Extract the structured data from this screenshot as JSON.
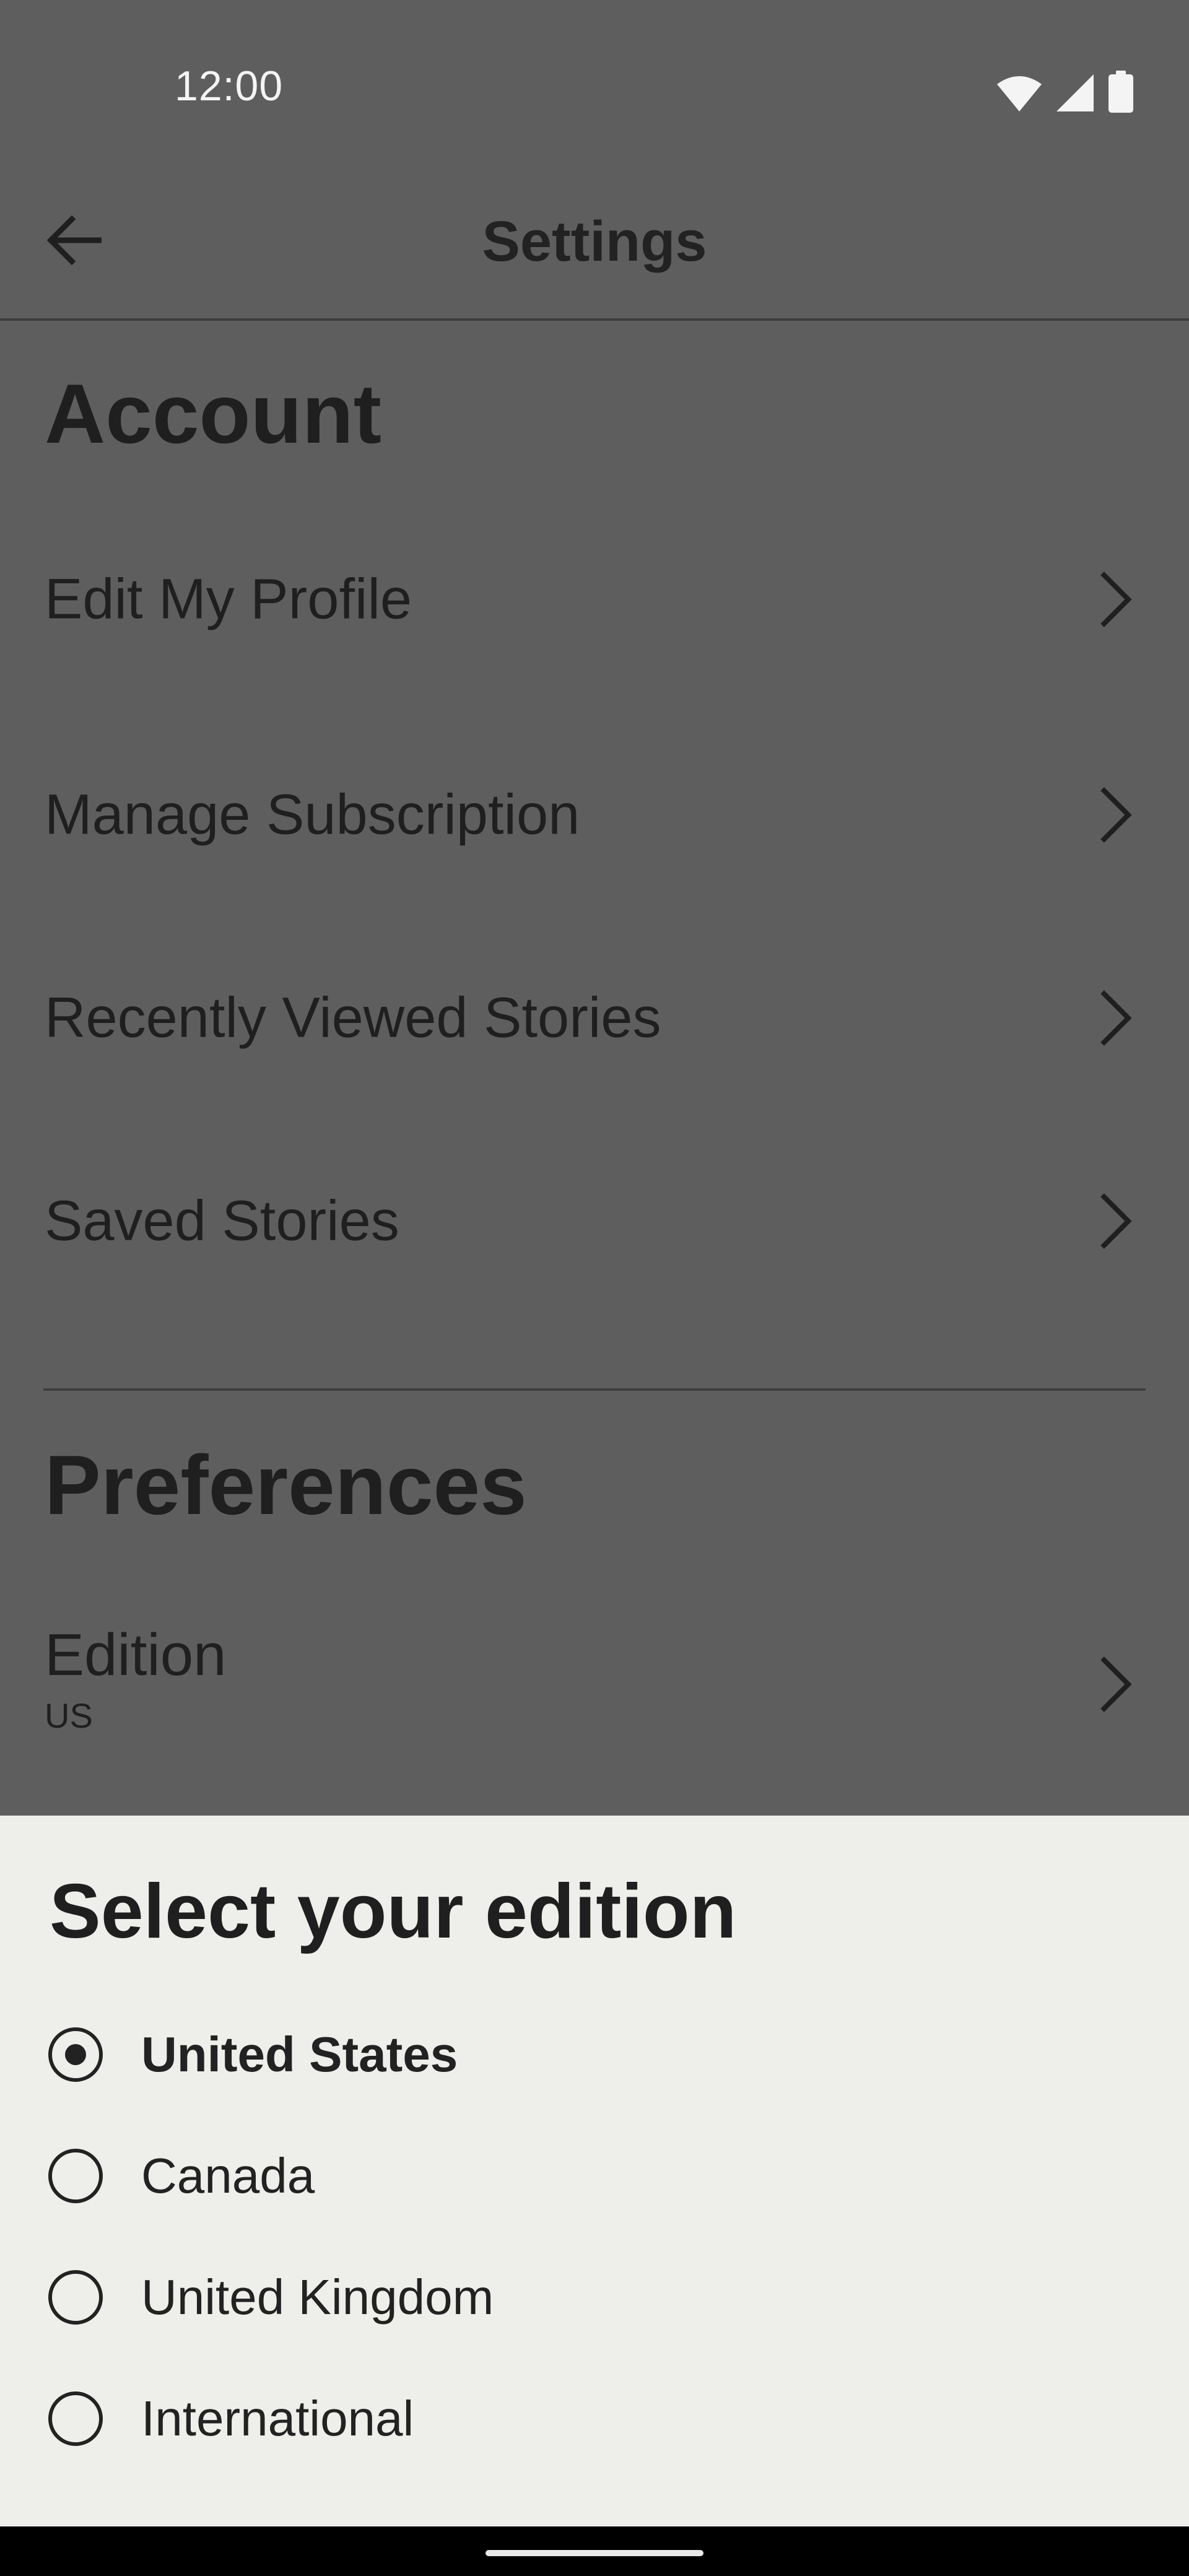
{
  "status_bar": {
    "time": "12:00",
    "icons": [
      "wifi-icon",
      "cellular-signal-icon",
      "battery-icon"
    ]
  },
  "app_bar": {
    "back_icon": "arrow-left-icon",
    "title": "Settings"
  },
  "account": {
    "heading": "Account",
    "items": [
      {
        "label": "Edit My Profile"
      },
      {
        "label": "Manage Subscription"
      },
      {
        "label": "Recently Viewed Stories"
      },
      {
        "label": "Saved Stories"
      }
    ]
  },
  "preferences": {
    "heading": "Preferences",
    "edition": {
      "label": "Edition",
      "value": "US"
    }
  },
  "edition_sheet": {
    "title": "Select your edition",
    "selected": "United States",
    "options": [
      {
        "label": "United States"
      },
      {
        "label": "Canada"
      },
      {
        "label": "United Kingdom"
      },
      {
        "label": "International"
      }
    ]
  },
  "colors": {
    "scrim_background": "#5e5e5e",
    "sheet_background": "#eeeeea",
    "text_primary": "#1f1f1f"
  }
}
